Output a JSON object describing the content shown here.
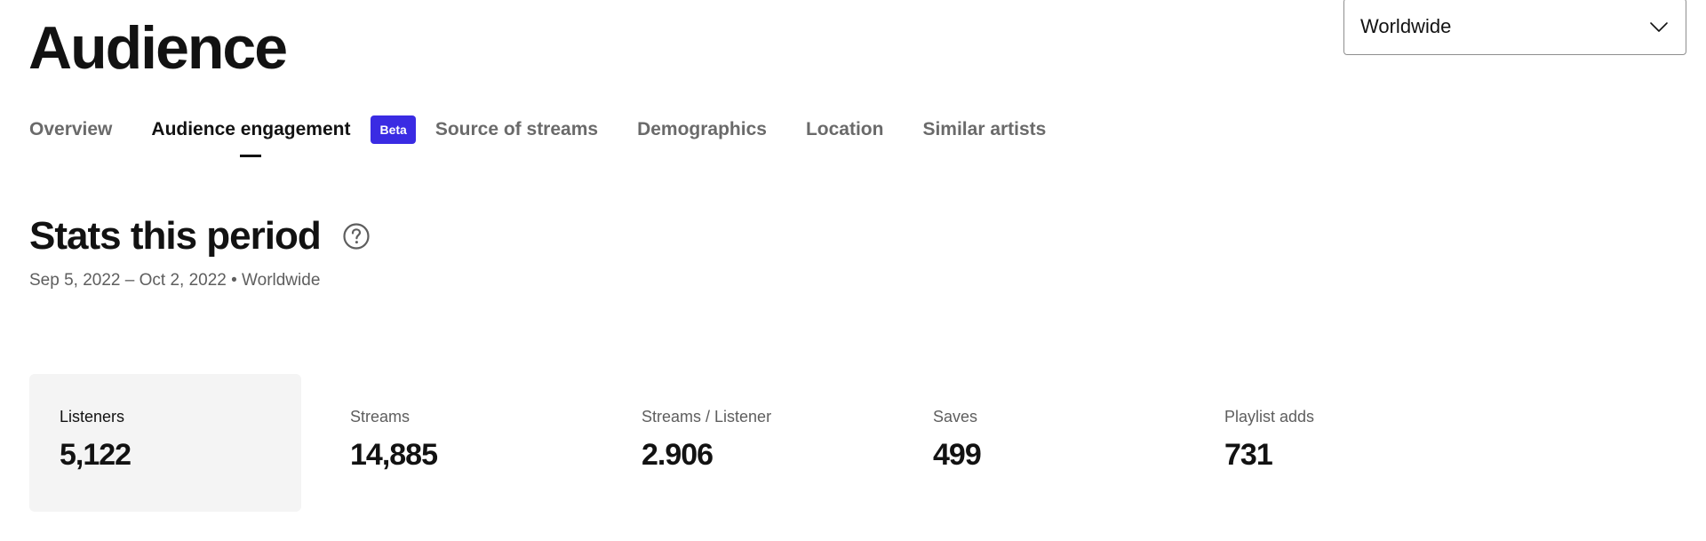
{
  "header": {
    "title": "Audience",
    "region_select": {
      "value": "Worldwide",
      "icon": "chevron-down-icon"
    }
  },
  "tabs": [
    {
      "label": "Overview",
      "active": false
    },
    {
      "label": "Audience engagement",
      "active": true
    },
    {
      "label": "Source of streams",
      "active": false
    },
    {
      "label": "Demographics",
      "active": false
    },
    {
      "label": "Location",
      "active": false
    },
    {
      "label": "Similar artists",
      "active": false
    }
  ],
  "beta_badge": "Beta",
  "colors": {
    "badge": "#3a2be3",
    "text": "#121212",
    "muted": "#6a6a6a",
    "card_bg": "#f4f4f4"
  },
  "section": {
    "title": "Stats this period",
    "help_icon": "help-circle-icon",
    "period": "Sep 5, 2022 – Oct 2, 2022 • Worldwide"
  },
  "stats": [
    {
      "label": "Listeners",
      "value": "5,122"
    },
    {
      "label": "Streams",
      "value": "14,885"
    },
    {
      "label": "Streams / Listener",
      "value": "2.906"
    },
    {
      "label": "Saves",
      "value": "499"
    },
    {
      "label": "Playlist adds",
      "value": "731"
    }
  ]
}
